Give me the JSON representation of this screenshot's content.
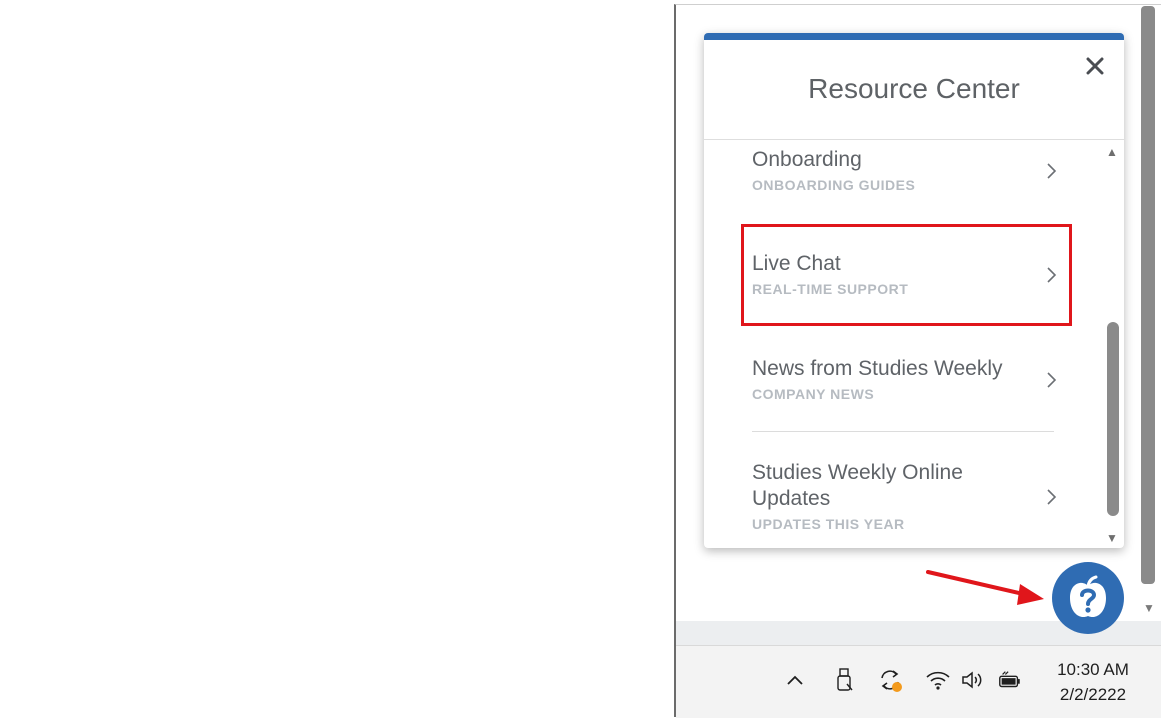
{
  "resource_center": {
    "title": "Resource Center",
    "items": [
      {
        "title": "Onboarding",
        "subtitle": "ONBOARDING GUIDES"
      },
      {
        "title": "Live Chat",
        "subtitle": "REAL-TIME SUPPORT"
      },
      {
        "title": "News from Studies Weekly",
        "subtitle": "COMPANY NEWS"
      },
      {
        "title": "Studies Weekly Online Updates",
        "subtitle": "UPDATES THIS YEAR"
      }
    ]
  },
  "taskbar": {
    "time": "10:30 AM",
    "date": "2/2/2222",
    "icons": [
      "chevron-up-icon",
      "usb-drive-icon",
      "sync-icon",
      "wifi-icon",
      "volume-icon",
      "battery-icon"
    ]
  },
  "colors": {
    "accent": "#2f6cb3",
    "highlight": "#e0161b"
  }
}
